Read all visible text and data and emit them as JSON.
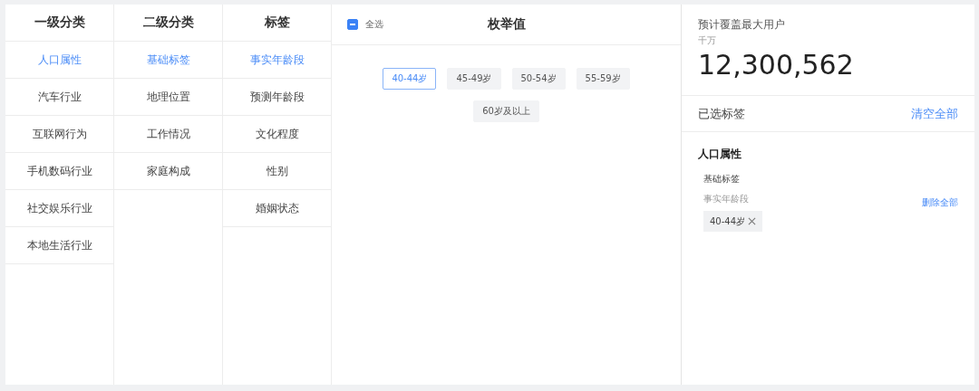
{
  "columns": [
    {
      "title": "一级分类",
      "items": [
        {
          "label": "人口属性",
          "selected": true
        },
        {
          "label": "汽车行业",
          "selected": false
        },
        {
          "label": "互联网行为",
          "selected": false
        },
        {
          "label": "手机数码行业",
          "selected": false
        },
        {
          "label": "社交娱乐行业",
          "selected": false
        },
        {
          "label": "本地生活行业",
          "selected": false
        }
      ]
    },
    {
      "title": "二级分类",
      "items": [
        {
          "label": "基础标签",
          "selected": true
        },
        {
          "label": "地理位置",
          "selected": false
        },
        {
          "label": "工作情况",
          "selected": false
        },
        {
          "label": "家庭构成",
          "selected": false
        }
      ]
    },
    {
      "title": "标签",
      "items": [
        {
          "label": "事实年龄段",
          "selected": true
        },
        {
          "label": "预测年龄段",
          "selected": false
        },
        {
          "label": "文化程度",
          "selected": false
        },
        {
          "label": "性别",
          "selected": false
        },
        {
          "label": "婚姻状态",
          "selected": false
        }
      ]
    }
  ],
  "enum": {
    "select_all": {
      "label": "全选",
      "indeterminate": true
    },
    "title": "枚举值",
    "values": [
      {
        "label": "40-44岁",
        "selected": true
      },
      {
        "label": "45-49岁",
        "selected": false
      },
      {
        "label": "50-54岁",
        "selected": false
      },
      {
        "label": "55-59岁",
        "selected": false
      },
      {
        "label": "60岁及以上",
        "selected": false
      }
    ]
  },
  "summary": {
    "title": "预计覆盖最大用户",
    "unit": "千万",
    "count": "12,300,562",
    "selected_title": "已选标签",
    "clear_all": "清空全部",
    "groups": [
      {
        "name": "人口属性",
        "subgroups": [
          {
            "name": "基础标签",
            "tag_name": "事实年龄段",
            "delete_all": "删除全部",
            "tags": [
              {
                "label": "40-44岁"
              }
            ]
          }
        ]
      }
    ]
  }
}
